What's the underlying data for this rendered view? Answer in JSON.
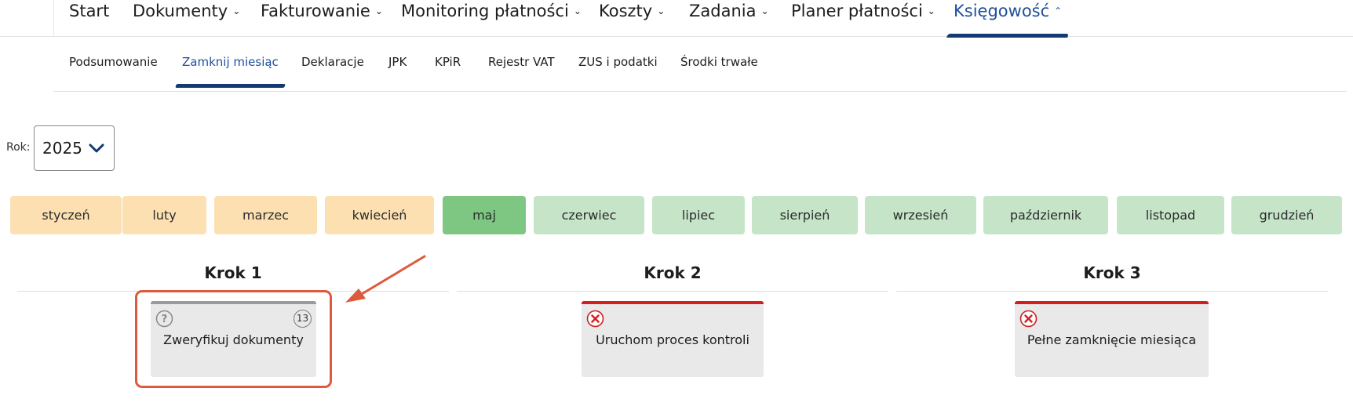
{
  "topnav": {
    "items": [
      {
        "label": "Start",
        "dropdown": false
      },
      {
        "label": "Dokumenty",
        "dropdown": true
      },
      {
        "label": "Fakturowanie",
        "dropdown": true
      },
      {
        "label": "Monitoring płatności",
        "dropdown": true
      },
      {
        "label": "Koszty",
        "dropdown": true
      },
      {
        "label": "Zadania",
        "dropdown": true
      },
      {
        "label": "Planer płatności",
        "dropdown": true
      },
      {
        "label": "Księgowość",
        "dropdown": true,
        "active": true
      }
    ],
    "chevron_down": "⌄",
    "chevron_up": "⌃"
  },
  "subnav": {
    "items": [
      {
        "label": "Podsumowanie"
      },
      {
        "label": "Zamknij miesiąc",
        "active": true
      },
      {
        "label": "Deklaracje"
      },
      {
        "label": "JPK"
      },
      {
        "label": "KPiR"
      },
      {
        "label": "Rejestr VAT"
      },
      {
        "label": "ZUS i podatki"
      },
      {
        "label": "Środki trwałe"
      }
    ]
  },
  "year": {
    "label": "Rok:",
    "value": "2025",
    "icon": "chevron-down-icon"
  },
  "months": [
    {
      "label": "styczeń",
      "status": "past"
    },
    {
      "label": "luty",
      "status": "past"
    },
    {
      "label": "marzec",
      "status": "past"
    },
    {
      "label": "kwiecień",
      "status": "past"
    },
    {
      "label": "maj",
      "status": "current"
    },
    {
      "label": "czerwiec",
      "status": "future"
    },
    {
      "label": "lipiec",
      "status": "future"
    },
    {
      "label": "sierpień",
      "status": "future"
    },
    {
      "label": "wrzesień",
      "status": "future"
    },
    {
      "label": "październik",
      "status": "future"
    },
    {
      "label": "listopad",
      "status": "future"
    },
    {
      "label": "grudzień",
      "status": "future"
    }
  ],
  "steps": [
    {
      "title": "Krok 1",
      "card": {
        "label": "Zweryfikuj dokumenty",
        "status_icon": "question-icon",
        "badge": "13",
        "bar": "gray"
      }
    },
    {
      "title": "Krok 2",
      "card": {
        "label": "Uruchom proces kontroli",
        "status_icon": "error-x-icon",
        "bar": "red"
      }
    },
    {
      "title": "Krok 3",
      "card": {
        "label": "Pełne zamknięcie miesiąca",
        "status_icon": "error-x-icon",
        "bar": "red"
      }
    }
  ],
  "colors": {
    "accent": "#1f4f9a",
    "nav_indicator": "#123a73",
    "month_past": "#fde0b2",
    "month_current": "#7dc782",
    "month_future": "#c6e5c8",
    "error": "#d21e1e",
    "annotation": "#de5a3c"
  }
}
